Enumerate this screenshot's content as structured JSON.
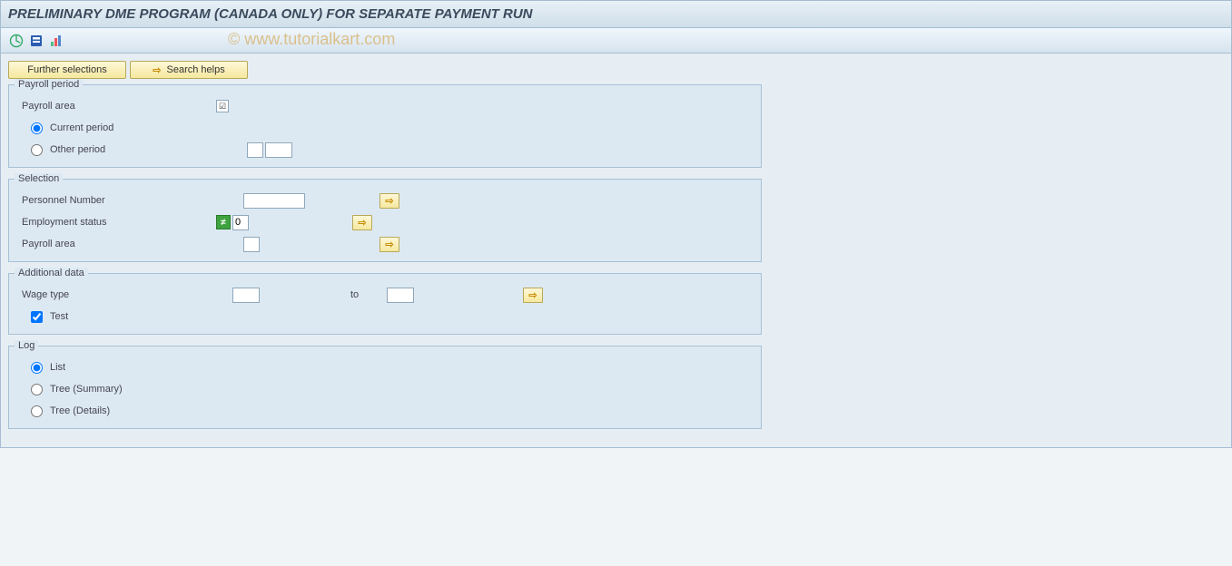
{
  "title": "PRELIMINARY DME PROGRAM (CANADA ONLY) FOR SEPARATE PAYMENT RUN",
  "watermark": "© www.tutorialkart.com",
  "buttons": {
    "further_selections": "Further selections",
    "search_helps": "Search helps"
  },
  "groups": {
    "payroll_period": {
      "legend": "Payroll period",
      "payroll_area_label": "Payroll area",
      "current_period_label": "Current period",
      "other_period_label": "Other period",
      "period_selected": "current",
      "other_period_val1": "",
      "other_period_val2": ""
    },
    "selection": {
      "legend": "Selection",
      "personnel_number_label": "Personnel Number",
      "personnel_number_value": "",
      "employment_status_label": "Employment status",
      "employment_status_value": "0",
      "payroll_area_label": "Payroll area",
      "payroll_area_value": ""
    },
    "additional_data": {
      "legend": "Additional data",
      "wage_type_label": "Wage type",
      "wage_type_from": "",
      "to_label": "to",
      "wage_type_to": "",
      "test_label": "Test",
      "test_checked": true
    },
    "log": {
      "legend": "Log",
      "list_label": "List",
      "tree_summary_label": "Tree (Summary)",
      "tree_details_label": "Tree (Details)",
      "selected": "list"
    }
  },
  "icons": {
    "arrow": "⇨",
    "neq": "≠",
    "f4": "☑"
  }
}
